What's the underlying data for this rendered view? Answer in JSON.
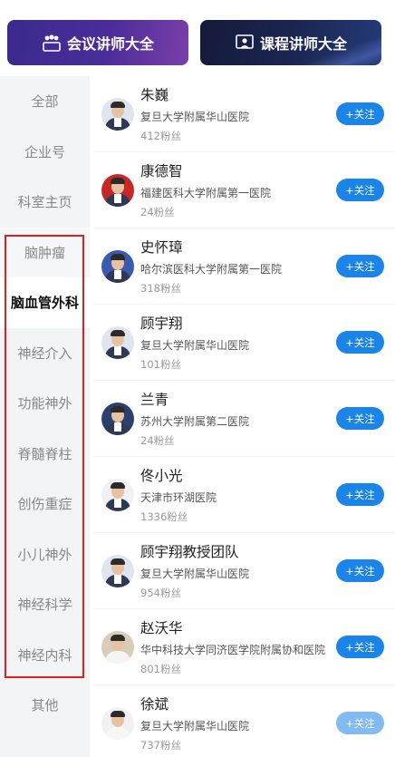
{
  "banners": {
    "left_label": "会议讲师大全",
    "right_label": "课程讲师大全"
  },
  "sidebar": {
    "items": [
      {
        "label": "全部"
      },
      {
        "label": "企业号"
      },
      {
        "label": "科室主页"
      },
      {
        "label": "脑肿瘤"
      },
      {
        "label": "脑血管外科"
      },
      {
        "label": "神经介入"
      },
      {
        "label": "功能神外"
      },
      {
        "label": "脊髓脊柱"
      },
      {
        "label": "创伤重症"
      },
      {
        "label": "小儿神外"
      },
      {
        "label": "神经科学"
      },
      {
        "label": "神经内科"
      },
      {
        "label": "其他"
      }
    ],
    "active_index": 4
  },
  "doctors": [
    {
      "name": "朱巍",
      "org": "复旦大学附属华山医院",
      "fans": "412粉丝",
      "follow": "+关注"
    },
    {
      "name": "康德智",
      "org": "福建医科大学附属第一医院",
      "fans": "24粉丝",
      "follow": "+关注"
    },
    {
      "name": "史怀璋",
      "org": "哈尔滨医科大学附属第一医院",
      "fans": "318粉丝",
      "follow": "+关注"
    },
    {
      "name": "顾宇翔",
      "org": "复旦大学附属华山医院",
      "fans": "101粉丝",
      "follow": "+关注"
    },
    {
      "name": "兰青",
      "org": "苏州大学附属第二医院",
      "fans": "24粉丝",
      "follow": "+关注"
    },
    {
      "name": "佟小光",
      "org": "天津市环湖医院",
      "fans": "1336粉丝",
      "follow": "+关注"
    },
    {
      "name": "顾宇翔教授团队",
      "org": "复旦大学附属华山医院",
      "fans": "954粉丝",
      "follow": "+关注"
    },
    {
      "name": "赵沃华",
      "org": "华中科技大学同济医学院附属协和医院",
      "fans": "801粉丝",
      "follow": "+关注"
    },
    {
      "name": "徐斌",
      "org": "复旦大学附属华山医院",
      "fans": "737粉丝",
      "follow": "+关注"
    }
  ],
  "colors": {
    "accent": "#1b84e8",
    "highlight_box": "#e0201f"
  }
}
